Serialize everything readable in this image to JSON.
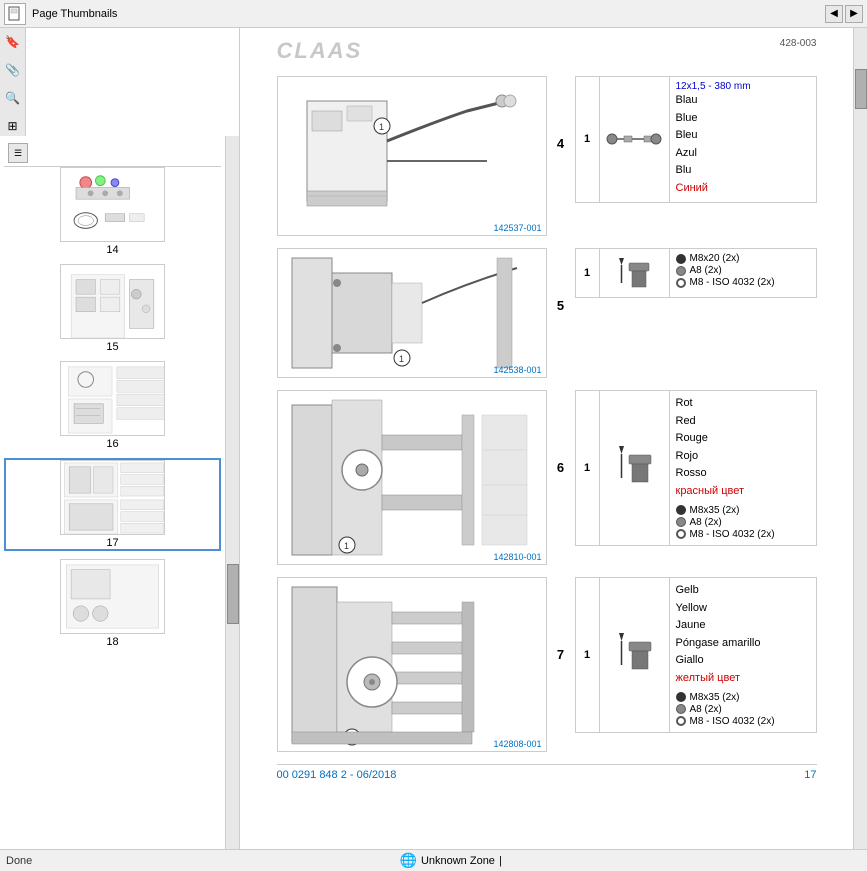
{
  "topbar": {
    "title": "Page Thumbnails",
    "prev_label": "◀",
    "next_label": "▶"
  },
  "sidebar": {
    "toolbar_icon": "☰",
    "left_icons": [
      "🔖",
      "📎",
      "🔍"
    ],
    "thumbnails": [
      {
        "id": 14,
        "label": "14",
        "active": false
      },
      {
        "id": 15,
        "label": "15",
        "active": false
      },
      {
        "id": 16,
        "label": "16",
        "active": false
      },
      {
        "id": 17,
        "label": "17",
        "active": true
      },
      {
        "id": 18,
        "label": "18",
        "active": false
      }
    ]
  },
  "document": {
    "logo": "CLAAS",
    "ref": "428-003",
    "section4": {
      "diagram_ref": "142537-001",
      "section_num": "4",
      "part1": {
        "num": "1",
        "part_name": "12x1,5 - 380 mm",
        "langs": [
          "Blau",
          "Blue",
          "Bleu",
          "Azul",
          "Blu",
          "Синий"
        ],
        "lang_colors": [
          "black",
          "black",
          "black",
          "black",
          "black",
          "red"
        ]
      }
    },
    "section5": {
      "diagram_ref": "142538-001",
      "section_num": "5",
      "part1": {
        "num": "1",
        "items": [
          {
            "type": "bolt",
            "text": "M8x20 (2x)"
          },
          {
            "type": "washer",
            "text": "A8 (2x)"
          },
          {
            "type": "outline",
            "text": "M8 - ISO 4032 (2x)"
          }
        ]
      }
    },
    "section6": {
      "diagram_ref": "142810-001",
      "section_num": "6",
      "part1": {
        "num": "1",
        "langs": [
          "Rot",
          "Red",
          "Rouge",
          "Rojo",
          "Rosso",
          "красный цвет"
        ],
        "lang_colors": [
          "black",
          "black",
          "black",
          "black",
          "black",
          "red"
        ],
        "items": [
          {
            "type": "bolt",
            "text": "M8x35 (2x)"
          },
          {
            "type": "washer",
            "text": "A8 (2x)"
          },
          {
            "type": "outline",
            "text": "M8 - ISO 4032 (2x)"
          }
        ]
      }
    },
    "section7": {
      "diagram_ref": "142808-001",
      "section_num": "7",
      "part1": {
        "num": "1",
        "langs": [
          "Gelb",
          "Yellow",
          "Jaune",
          "Póngase amarillo",
          "Giallo",
          "желтый цвет"
        ],
        "lang_colors": [
          "black",
          "black",
          "black",
          "black",
          "black",
          "red"
        ],
        "items": [
          {
            "type": "bolt",
            "text": "M8x35 (2x)"
          },
          {
            "type": "washer",
            "text": "A8 (2x)"
          },
          {
            "type": "outline",
            "text": "M8 - ISO 4032 (2x)"
          }
        ]
      }
    },
    "footer_left": "00 0291 848 2 - 06/2018",
    "footer_right": "17"
  },
  "statusbar": {
    "done": "Done",
    "zone": "Unknown Zone"
  }
}
